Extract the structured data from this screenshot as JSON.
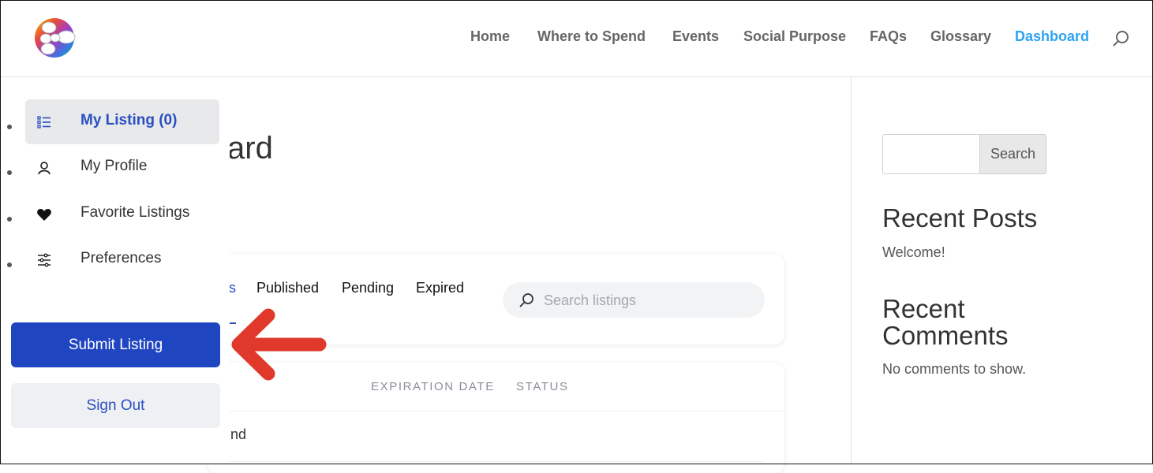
{
  "header": {
    "nav": [
      {
        "label": "Home",
        "active": false
      },
      {
        "label": "Where to Spend",
        "active": false
      },
      {
        "label": "Events",
        "active": false
      },
      {
        "label": "Social Purpose",
        "active": false
      },
      {
        "label": "FAQs",
        "active": false
      },
      {
        "label": "Glossary",
        "active": false
      },
      {
        "label": "Dashboard",
        "active": true
      }
    ]
  },
  "main": {
    "title_partial": "ard",
    "tabs": {
      "first_partial": "s",
      "items": [
        "Published",
        "Pending",
        "Expired"
      ]
    },
    "search": {
      "placeholder": "Search listings"
    },
    "table": {
      "columns": [
        "EXPIRATION DATE",
        "STATUS"
      ],
      "first_row_partial": "nd"
    }
  },
  "dashboard_menu": {
    "items": [
      {
        "label": "My Listing (0)",
        "icon": "list-icon",
        "active": true
      },
      {
        "label": "My Profile",
        "icon": "user-icon",
        "active": false
      },
      {
        "label": "Favorite Listings",
        "icon": "heart-icon",
        "active": false
      },
      {
        "label": "Preferences",
        "icon": "sliders-icon",
        "active": false
      }
    ],
    "submit_label": "Submit Listing",
    "signout_label": "Sign Out"
  },
  "sidebar": {
    "search_button": "Search",
    "recent_posts_title": "Recent Posts",
    "recent_posts": [
      "Welcome!"
    ],
    "recent_comments_title": "Recent Comments",
    "recent_comments_empty": "No comments to show."
  },
  "colors": {
    "accent": "#2ea3f2",
    "primary_button": "#2045c1",
    "annotation_arrow": "#e0392b"
  }
}
